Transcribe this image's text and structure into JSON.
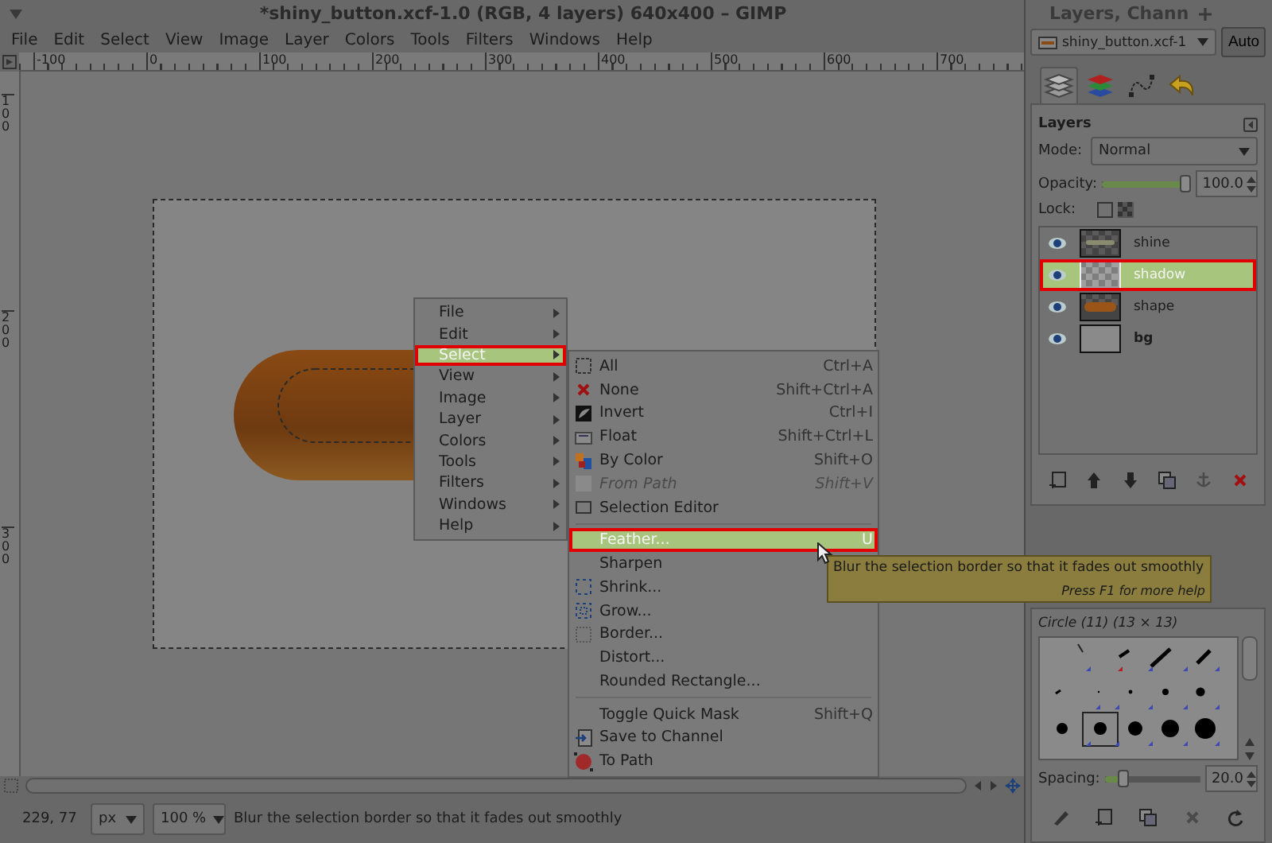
{
  "window": {
    "title": "*shiny_button.xcf-1.0 (RGB, 4 layers) 640x400 – GIMP"
  },
  "menubar": [
    "File",
    "Edit",
    "Select",
    "View",
    "Image",
    "Layer",
    "Colors",
    "Tools",
    "Filters",
    "Windows",
    "Help"
  ],
  "rulers": {
    "horizontal": [
      "-100",
      "0",
      "100",
      "200",
      "300",
      "400",
      "500",
      "600",
      "700"
    ],
    "vertical": [
      "100",
      "200",
      "300"
    ]
  },
  "context_menu": [
    {
      "label": "File",
      "selected": false
    },
    {
      "label": "Edit",
      "selected": false
    },
    {
      "label": "Select",
      "selected": true
    },
    {
      "label": "View",
      "selected": false
    },
    {
      "label": "Image",
      "selected": false
    },
    {
      "label": "Layer",
      "selected": false
    },
    {
      "label": "Colors",
      "selected": false
    },
    {
      "label": "Tools",
      "selected": false
    },
    {
      "label": "Filters",
      "selected": false
    },
    {
      "label": "Windows",
      "selected": false
    },
    {
      "label": "Help",
      "selected": false
    }
  ],
  "submenu": [
    {
      "kind": "item",
      "label": "All",
      "shortcut": "Ctrl+A",
      "disabled": false,
      "selected": false
    },
    {
      "kind": "item",
      "label": "None",
      "shortcut": "Shift+Ctrl+A",
      "disabled": false,
      "selected": false
    },
    {
      "kind": "item",
      "label": "Invert",
      "shortcut": "Ctrl+I",
      "disabled": false,
      "selected": false
    },
    {
      "kind": "item",
      "label": "Float",
      "shortcut": "Shift+Ctrl+L",
      "disabled": false,
      "selected": false
    },
    {
      "kind": "item",
      "label": "By Color",
      "shortcut": "Shift+O",
      "disabled": false,
      "selected": false
    },
    {
      "kind": "item",
      "label": "From Path",
      "shortcut": "Shift+V",
      "disabled": true,
      "selected": false
    },
    {
      "kind": "item",
      "label": "Selection Editor",
      "disabled": false,
      "selected": false
    },
    {
      "kind": "separator"
    },
    {
      "kind": "item",
      "label": "Feather...",
      "shortcut": "U",
      "disabled": false,
      "selected": true
    },
    {
      "kind": "item",
      "label": "Sharpen",
      "disabled": false,
      "selected": false
    },
    {
      "kind": "item",
      "label": "Shrink...",
      "disabled": false,
      "selected": false
    },
    {
      "kind": "item",
      "label": "Grow...",
      "disabled": false,
      "selected": false
    },
    {
      "kind": "item",
      "label": "Border...",
      "disabled": false,
      "selected": false
    },
    {
      "kind": "item",
      "label": "Distort...",
      "disabled": false,
      "selected": false
    },
    {
      "kind": "item",
      "label": "Rounded Rectangle...",
      "disabled": false,
      "selected": false
    },
    {
      "kind": "separator"
    },
    {
      "kind": "item",
      "label": "Toggle Quick Mask",
      "shortcut": "Shift+Q",
      "disabled": false,
      "selected": false
    },
    {
      "kind": "item",
      "label": "Save to Channel",
      "disabled": false,
      "selected": false
    },
    {
      "kind": "item",
      "label": "To Path",
      "disabled": false,
      "selected": false
    }
  ],
  "tooltip": {
    "text": "Blur the selection border so that it fades out smoothly",
    "hint": "Press F1 for more help"
  },
  "status_bar": {
    "coordinates": "229, 77",
    "unit": "px",
    "zoom": "100 %",
    "message": "Blur the selection border so that it fades out smoothly"
  },
  "dock": {
    "title": "Layers, Chann",
    "image": "shiny_button.xcf-1",
    "auto_button": "Auto",
    "tabs": [
      {
        "selected": true
      },
      {
        "selected": false
      },
      {
        "selected": false
      },
      {
        "selected": false
      }
    ],
    "layers_panel": {
      "title": "Layers",
      "mode_label": "Mode:",
      "mode": "Normal",
      "opacity_label": "Opacity:",
      "opacity": {
        "level": 1.0
      },
      "opacity_value": "100.0",
      "lock_label": "Lock:",
      "lock_checked": false,
      "layers": [
        {
          "name": "shine",
          "visible": true,
          "selected": false,
          "kind": "layer"
        },
        {
          "name": "shadow",
          "visible": true,
          "selected": true,
          "kind": "layer"
        },
        {
          "name": "shape",
          "visible": true,
          "selected": false,
          "kind": "layer"
        },
        {
          "name": "bg",
          "visible": true,
          "selected": false,
          "kind": "background"
        }
      ]
    },
    "brushes_panel": {
      "title": "Circle (11) (13 × 13)",
      "spacing_label": "Spacing:",
      "spacing": {
        "level": 0.15
      },
      "spacing_value": "20.0"
    }
  }
}
